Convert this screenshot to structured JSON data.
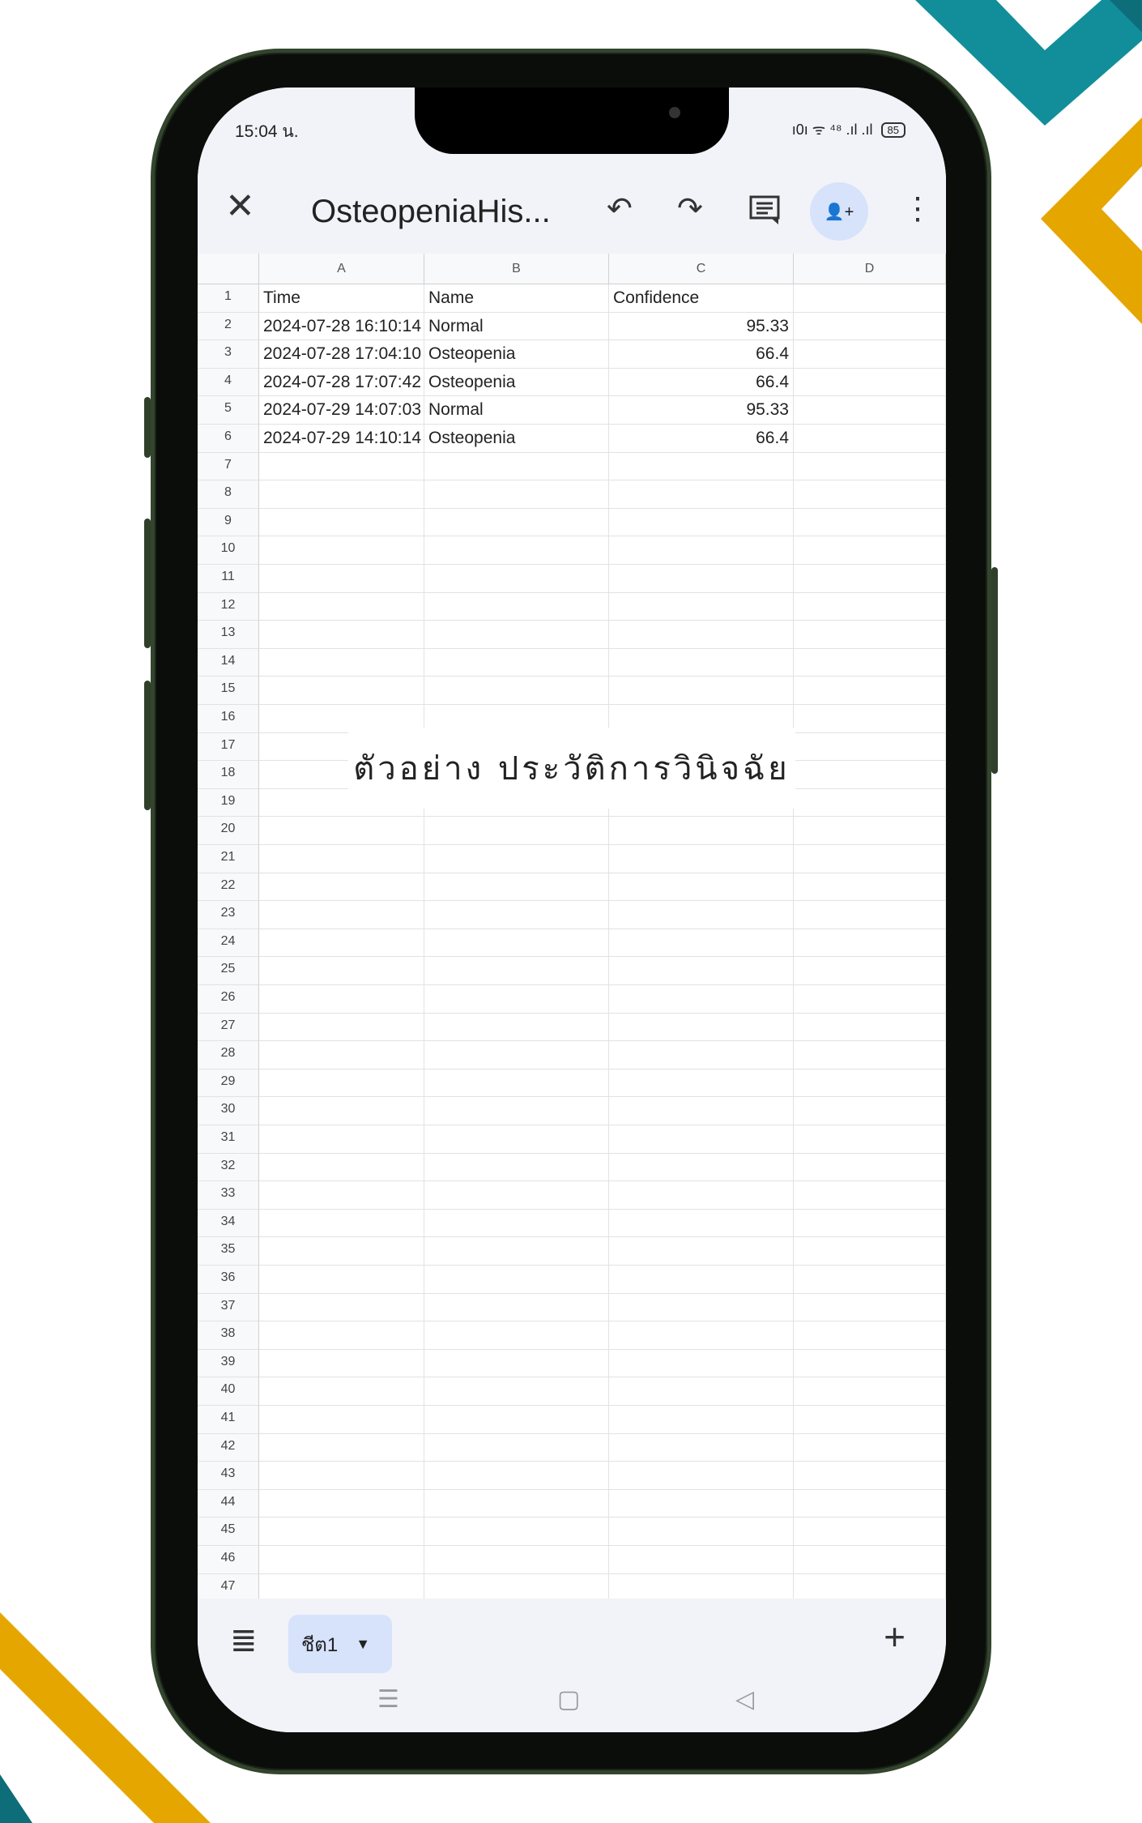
{
  "status_bar": {
    "time": "15:04 น.",
    "icons": "ı0ı ᯤ ⁴⁸ .ıl .ıl",
    "battery": "85"
  },
  "toolbar": {
    "close_icon": "close-icon",
    "title": "OsteopeniaHis...",
    "undo_icon": "↶",
    "redo_icon": "↷",
    "comment_icon": "☰",
    "share_icon": "👤+",
    "more_icon": "⋮"
  },
  "sheet": {
    "columns": [
      "A",
      "B",
      "C",
      "D"
    ],
    "header_row": {
      "num": "1",
      "a": "Time",
      "b": "Name",
      "c": "Confidence"
    },
    "rows": [
      {
        "num": "2",
        "a": "2024-07-28 16:10:14",
        "b": "Normal",
        "c": "95.33"
      },
      {
        "num": "3",
        "a": "2024-07-28 17:04:10",
        "b": "Osteopenia",
        "c": "66.4"
      },
      {
        "num": "4",
        "a": "2024-07-28 17:07:42",
        "b": "Osteopenia",
        "c": "66.4"
      },
      {
        "num": "5",
        "a": "2024-07-29 14:07:03",
        "b": "Normal",
        "c": "95.33"
      },
      {
        "num": "6",
        "a": "2024-07-29 14:10:14",
        "b": "Osteopenia",
        "c": "66.4"
      }
    ],
    "empty_rows": [
      "7",
      "8",
      "9",
      "10",
      "11",
      "12",
      "13",
      "14",
      "15",
      "16",
      "17",
      "18",
      "19",
      "20",
      "21",
      "22",
      "23",
      "24",
      "25",
      "26",
      "27",
      "28",
      "29",
      "30",
      "31",
      "32",
      "33",
      "34",
      "35",
      "36",
      "37",
      "38",
      "39",
      "40",
      "41",
      "42",
      "43",
      "44",
      "45",
      "46",
      "47"
    ]
  },
  "overlay_caption": "ตัวอย่าง ประวัติการวินิจฉัย",
  "bottom_bar": {
    "menu_icon": "≣",
    "sheet_tab_label": "ชีต1",
    "sheet_tab_caret": "▼",
    "add_sheet": "+",
    "nav_recent": "☰",
    "nav_home": "▢",
    "nav_back": "◁"
  },
  "colors": {
    "accent_teal": "#128e9b",
    "accent_gold": "#e6a600",
    "tab_bg": "#d7e2fb"
  }
}
